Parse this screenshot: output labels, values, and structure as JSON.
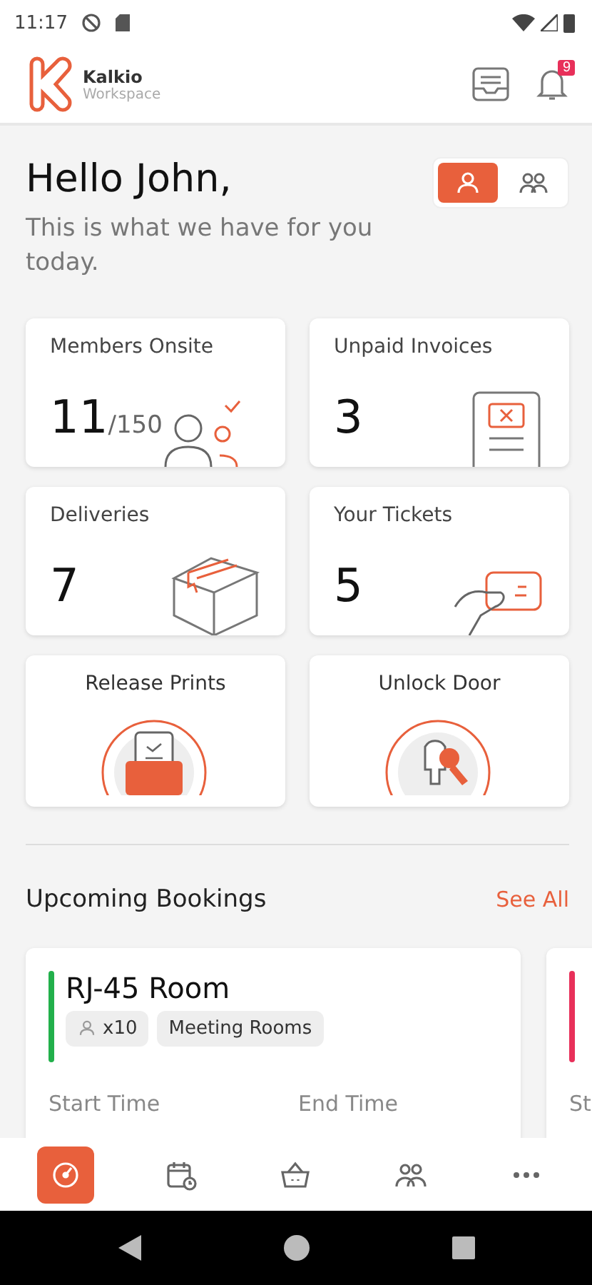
{
  "status_bar": {
    "time": "11:17"
  },
  "header": {
    "brand": "Kalkio",
    "subtitle": "Workspace",
    "notification_count": "9"
  },
  "greeting": {
    "title": "Hello John,",
    "subtitle": "This is what we have for you today."
  },
  "view_toggle": [
    {
      "kind": "person",
      "selected": true
    },
    {
      "kind": "group",
      "selected": false
    }
  ],
  "stats": [
    {
      "kind": "members",
      "label": "Members Onsite",
      "value": "11",
      "total": "/150"
    },
    {
      "kind": "invoices",
      "label": "Unpaid Invoices",
      "value": "3"
    },
    {
      "kind": "deliveries",
      "label": "Deliveries",
      "value": "7"
    },
    {
      "kind": "tickets",
      "label": "Your Tickets",
      "value": "5"
    }
  ],
  "actions": [
    {
      "kind": "print",
      "label": "Release Prints"
    },
    {
      "kind": "door",
      "label": "Unlock Door"
    }
  ],
  "bookings": {
    "title": "Upcoming Bookings",
    "link": "See All",
    "items": [
      {
        "title": "RJ-45 Room",
        "color": "#22b04b",
        "capacity": "x10",
        "category": "Meeting Rooms",
        "start_label": "Start Time",
        "end_label": "End Time"
      },
      {
        "color": "#e8305a",
        "start_label": "St"
      }
    ]
  },
  "bottom_nav": [
    {
      "kind": "dashboard",
      "selected": true
    },
    {
      "kind": "calendar",
      "selected": false
    },
    {
      "kind": "basket",
      "selected": false
    },
    {
      "kind": "members",
      "selected": false
    },
    {
      "kind": "more",
      "selected": false
    }
  ]
}
